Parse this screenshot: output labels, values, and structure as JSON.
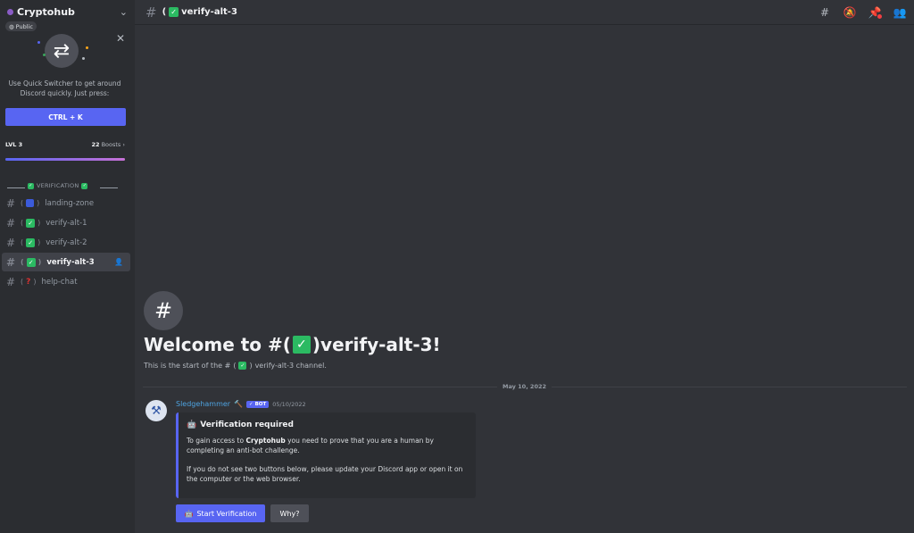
{
  "server": {
    "name": "Cryptohub",
    "visibility": "Public"
  },
  "quick_switcher": {
    "text": "Use Quick Switcher to get around Discord quickly. Just press:",
    "shortcut": "CTRL + K"
  },
  "boost": {
    "level": "LVL 3",
    "count": "22",
    "count_label": "Boosts",
    "progress": 1.0
  },
  "category": {
    "label": "VERIFICATION"
  },
  "channels": [
    {
      "name": "landing-zone",
      "emoji": "blue-square"
    },
    {
      "name": "verify-alt-1",
      "emoji": "check"
    },
    {
      "name": "verify-alt-2",
      "emoji": "check"
    },
    {
      "name": "verify-alt-3",
      "emoji": "check"
    },
    {
      "name": "help-chat",
      "emoji": "question"
    }
  ],
  "active_channel": "verify-alt-3",
  "topbar": {
    "title": "verify-alt-3"
  },
  "welcome": {
    "prefix": "Welcome to #(",
    "suffix": ")verify-alt-3!",
    "sub_prefix": "This is the start of the #",
    "sub_suffix": "verify-alt-3 channel."
  },
  "date_divider": "May 10, 2022",
  "message": {
    "author": "Sledgehammer",
    "bot_badge": "BOT",
    "timestamp": "05/10/2022",
    "embed_title": "Verification required",
    "desc_part1": "To gain access to ",
    "desc_server": "Cryptohub",
    "desc_part2": " you need to prove that you are a human by completing an anti-bot challenge.",
    "desc_para2": "If you do not see two buttons below, please update your Discord app or open it on the computer or the web browser."
  },
  "buttons": {
    "start": "Start Verification",
    "why": "Why?"
  },
  "colors": {
    "blurple": "#5865f2",
    "check_green": "#2bba62",
    "author_blue": "#4ea3e0"
  }
}
